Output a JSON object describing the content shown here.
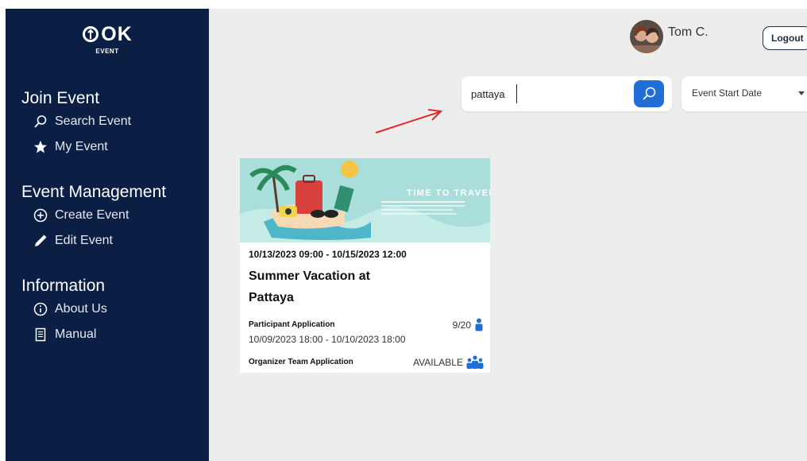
{
  "brand": {
    "logo_text": "OK",
    "logo_sub": "EVENT"
  },
  "sidebar": {
    "sections": [
      {
        "heading": "Join Event",
        "items": [
          {
            "label": "Search Event",
            "icon": "search-icon"
          },
          {
            "label": "My Event",
            "icon": "star-icon"
          }
        ]
      },
      {
        "heading": "Event Management",
        "items": [
          {
            "label": "Create Event",
            "icon": "plus-circle-icon"
          },
          {
            "label": "Edit Event",
            "icon": "pencil-icon"
          }
        ]
      },
      {
        "heading": "Information",
        "items": [
          {
            "label": "About Us",
            "icon": "info-circle-icon"
          },
          {
            "label": "Manual",
            "icon": "document-icon"
          }
        ]
      }
    ]
  },
  "header": {
    "user_name": "Tom C.",
    "logout_label": "Logout"
  },
  "search": {
    "value": "pattaya",
    "button_icon": "search-icon"
  },
  "sort": {
    "selected": "Event Start Date"
  },
  "colors": {
    "sidebar": "#0b1f45",
    "accent": "#1f6fd6",
    "annotation": "#e0282d",
    "background": "#ededed"
  },
  "event_card": {
    "banner_text": "TIME TO TRAVEL",
    "dates": "10/13/2023 09:00 - 10/15/2023 12:00",
    "title": "Summer Vacation at Pattaya",
    "participant_label": "Participant Application",
    "participant_count": "9/20",
    "participant_period": "10/09/2023 18:00 - 10/10/2023 18:00",
    "organizer_label": "Organizer Team Application",
    "organizer_status": "AVAILABLE"
  }
}
